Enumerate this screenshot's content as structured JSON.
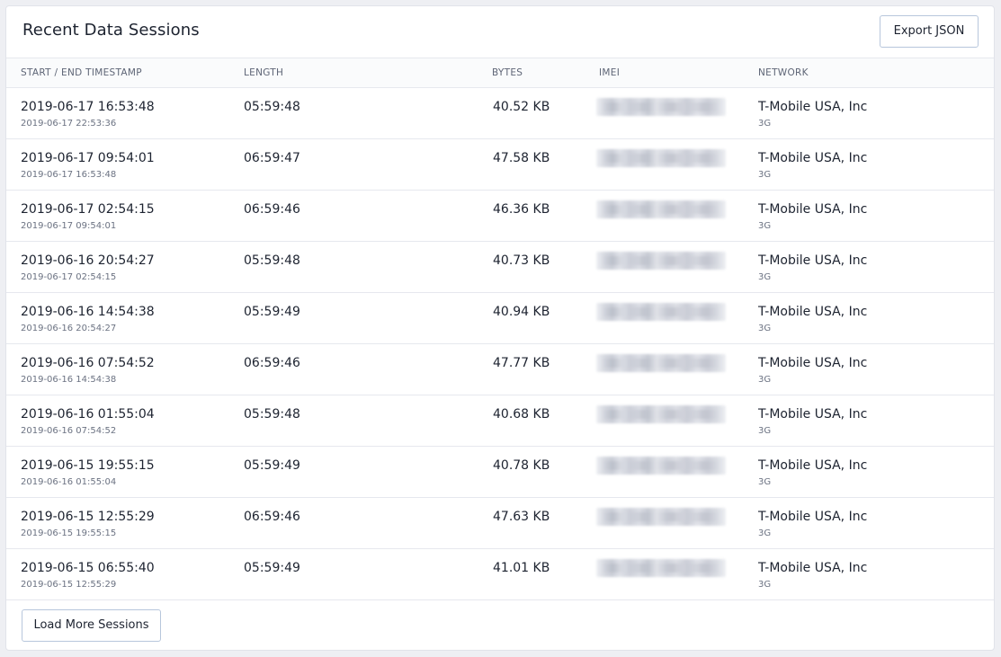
{
  "header": {
    "title": "Recent Data Sessions",
    "export_label": "Export JSON"
  },
  "columns": {
    "timestamp": "START / END TIMESTAMP",
    "length": "LENGTH",
    "bytes": "BYTES",
    "imei": "IMEI",
    "network": "NETWORK"
  },
  "rows": [
    {
      "start": "2019-06-17 16:53:48",
      "end": "2019-06-17 22:53:36",
      "length": "05:59:48",
      "bytes": "40.52 KB",
      "network": "T-Mobile USA, Inc",
      "network_type": "3G"
    },
    {
      "start": "2019-06-17 09:54:01",
      "end": "2019-06-17 16:53:48",
      "length": "06:59:47",
      "bytes": "47.58 KB",
      "network": "T-Mobile USA, Inc",
      "network_type": "3G"
    },
    {
      "start": "2019-06-17 02:54:15",
      "end": "2019-06-17 09:54:01",
      "length": "06:59:46",
      "bytes": "46.36 KB",
      "network": "T-Mobile USA, Inc",
      "network_type": "3G"
    },
    {
      "start": "2019-06-16 20:54:27",
      "end": "2019-06-17 02:54:15",
      "length": "05:59:48",
      "bytes": "40.73 KB",
      "network": "T-Mobile USA, Inc",
      "network_type": "3G"
    },
    {
      "start": "2019-06-16 14:54:38",
      "end": "2019-06-16 20:54:27",
      "length": "05:59:49",
      "bytes": "40.94 KB",
      "network": "T-Mobile USA, Inc",
      "network_type": "3G"
    },
    {
      "start": "2019-06-16 07:54:52",
      "end": "2019-06-16 14:54:38",
      "length": "06:59:46",
      "bytes": "47.77 KB",
      "network": "T-Mobile USA, Inc",
      "network_type": "3G"
    },
    {
      "start": "2019-06-16 01:55:04",
      "end": "2019-06-16 07:54:52",
      "length": "05:59:48",
      "bytes": "40.68 KB",
      "network": "T-Mobile USA, Inc",
      "network_type": "3G"
    },
    {
      "start": "2019-06-15 19:55:15",
      "end": "2019-06-16 01:55:04",
      "length": "05:59:49",
      "bytes": "40.78 KB",
      "network": "T-Mobile USA, Inc",
      "network_type": "3G"
    },
    {
      "start": "2019-06-15 12:55:29",
      "end": "2019-06-15 19:55:15",
      "length": "06:59:46",
      "bytes": "47.63 KB",
      "network": "T-Mobile USA, Inc",
      "network_type": "3G"
    },
    {
      "start": "2019-06-15 06:55:40",
      "end": "2019-06-15 12:55:29",
      "length": "05:59:49",
      "bytes": "41.01 KB",
      "network": "T-Mobile USA, Inc",
      "network_type": "3G"
    }
  ],
  "footer": {
    "load_more_label": "Load More Sessions"
  },
  "colors": {
    "background": "#eeeff3",
    "card": "#ffffff",
    "border": "#e6e8ee",
    "button_border": "#b7c6dc",
    "text_primary": "#1d2330",
    "text_secondary": "#6b7282"
  }
}
